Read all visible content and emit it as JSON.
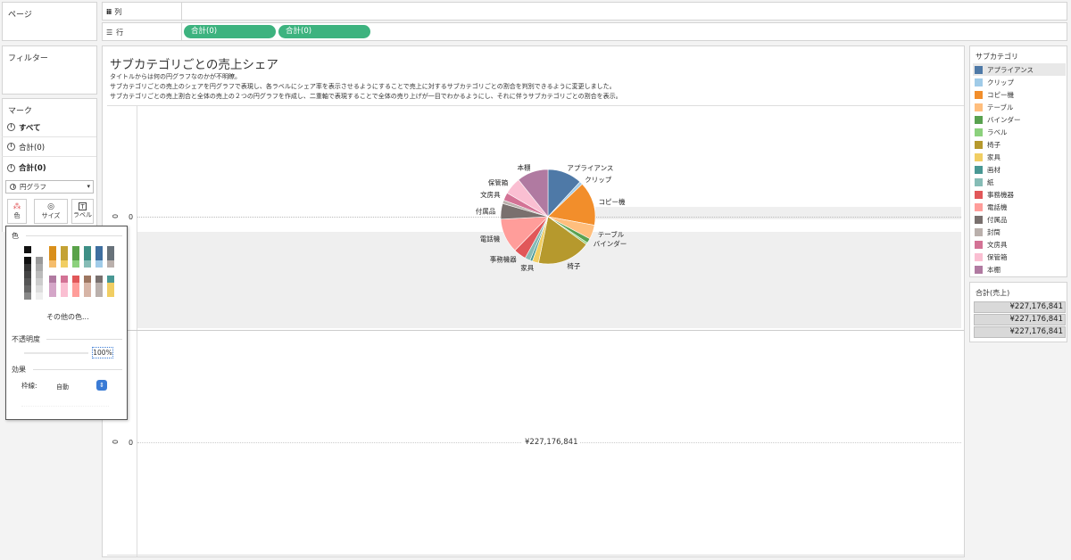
{
  "left": {
    "pages_title": "ページ",
    "filters_title": "フィルター",
    "marks_title": "マーク",
    "marks_rows": [
      "すべて",
      "合計(0)",
      "合計(0)"
    ],
    "mark_type": "円グラフ",
    "mark_buttons": [
      "色",
      "サイズ",
      "ラベル"
    ]
  },
  "shelves": {
    "columns_label": "列",
    "rows_label": "行",
    "row_pills": [
      "合計(0)",
      "合計(0)"
    ]
  },
  "color_popup": {
    "title": "色",
    "more_colors": "その他の色...",
    "opacity_label": "不透明度",
    "opacity_value": "100%",
    "effects_label": "効果",
    "border_label": "枠線:",
    "border_value": "自動"
  },
  "view": {
    "title": "サブカテゴリごとの売上シェア",
    "description_lines": [
      "タイトルからは何の円グラフなのかが不明瞭。",
      "サブカテゴリごとの売上のシェアを円グラフで表現し、各ラベルにシェア率を表示させるようにすることで売上に対するサブカテゴリごとの割合を判別できるように変更しました。",
      "サブカテゴリごとの売上割合と全体の売上の２つの円グラフを作成し、二重軸で表現することで全体の売り上げが一目でわかるようにし、それに伴うサブカテゴリごとの割合を表示。"
    ],
    "axis_zero_top": "0",
    "axis_tick_top": "0",
    "axis_zero_bottom": "0",
    "axis_tick_bottom": "0",
    "total_label": "¥227,176,841"
  },
  "legend": {
    "title": "サブカテゴリ",
    "items": [
      {
        "label": "アプライアンス",
        "color": "#4e79a7"
      },
      {
        "label": "クリップ",
        "color": "#a0cbe8"
      },
      {
        "label": "コピー機",
        "color": "#f28e2b"
      },
      {
        "label": "テーブル",
        "color": "#ffbe7d"
      },
      {
        "label": "バインダー",
        "color": "#59a14f"
      },
      {
        "label": "ラベル",
        "color": "#8cd17d"
      },
      {
        "label": "椅子",
        "color": "#b6992d"
      },
      {
        "label": "家具",
        "color": "#f1ce63"
      },
      {
        "label": "画材",
        "color": "#499894"
      },
      {
        "label": "紙",
        "color": "#86bcb6"
      },
      {
        "label": "事務機器",
        "color": "#e15759"
      },
      {
        "label": "電話機",
        "color": "#ff9d9a"
      },
      {
        "label": "付属品",
        "color": "#79706e"
      },
      {
        "label": "封筒",
        "color": "#bab0ac"
      },
      {
        "label": "文房具",
        "color": "#d37295"
      },
      {
        "label": "保管箱",
        "color": "#fabfd2"
      },
      {
        "label": "本棚",
        "color": "#b07aa1"
      }
    ]
  },
  "totals": {
    "title": "合計(売上)",
    "values": [
      "¥227,176,841",
      "¥227,176,841",
      "¥227,176,841"
    ]
  },
  "chart_data": {
    "type": "pie",
    "title": "サブカテゴリごとの売上シェア",
    "categories": [
      "アプライアンス",
      "クリップ",
      "コピー機",
      "テーブル",
      "バインダー",
      "ラベル",
      "椅子",
      "家具",
      "画材",
      "紙",
      "事務機器",
      "電話機",
      "付属品",
      "封筒",
      "文房具",
      "保管箱",
      "本棚"
    ],
    "values": [
      11.0,
      1.0,
      14.0,
      4.5,
      1.5,
      0.6,
      17.0,
      2.0,
      0.8,
      1.7,
      4.0,
      11.0,
      5.0,
      1.1,
      2.5,
      5.5,
      10.0
    ],
    "labels_shown": [
      "アプライアンス",
      "クリップ",
      "コピー機",
      "テーブル",
      "バインダー",
      "椅子",
      "家具",
      "事務機器",
      "電話機",
      "付属品",
      "文房具",
      "保管箱",
      "本棚"
    ],
    "total": "¥227,176,841"
  }
}
